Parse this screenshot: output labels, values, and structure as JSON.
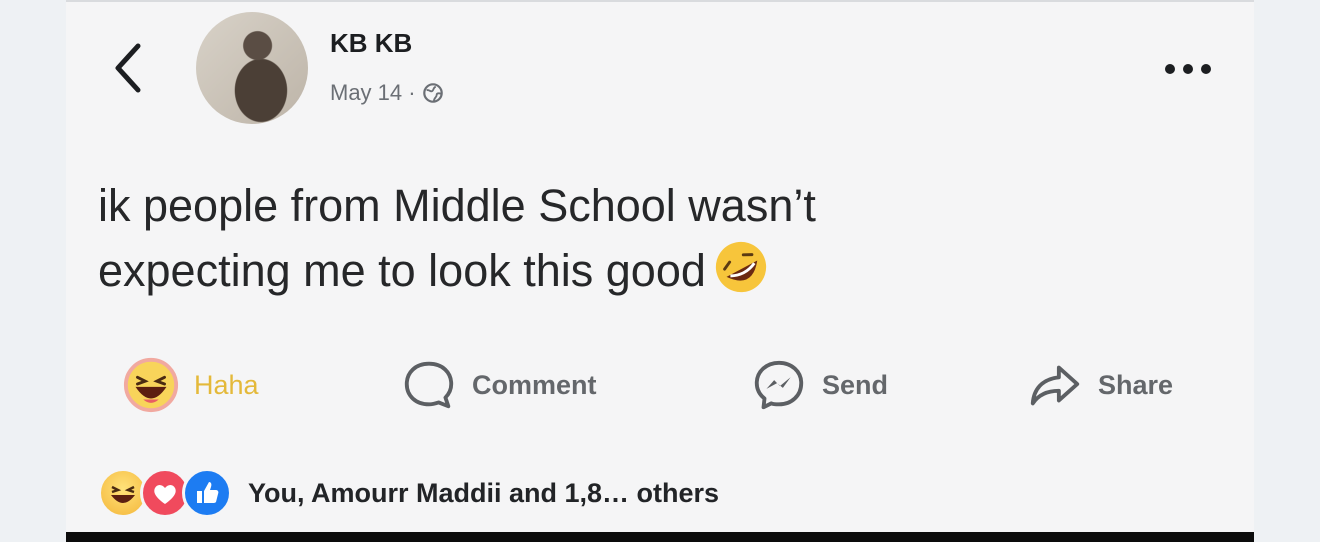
{
  "post": {
    "author": "KB KB",
    "date": "May 14 ·",
    "text_line1": "ik people from Middle School wasn’t",
    "text_line2": "expecting me to look this good"
  },
  "actions": {
    "haha": "Haha",
    "comment": "Comment",
    "send": "Send",
    "share": "Share"
  },
  "reactions": {
    "summary": "You, Amourr Maddii and 1,8… others"
  },
  "colors": {
    "haha_accent": "#e4b93a",
    "love": "#f04a5d",
    "like": "#1d7cf2"
  }
}
